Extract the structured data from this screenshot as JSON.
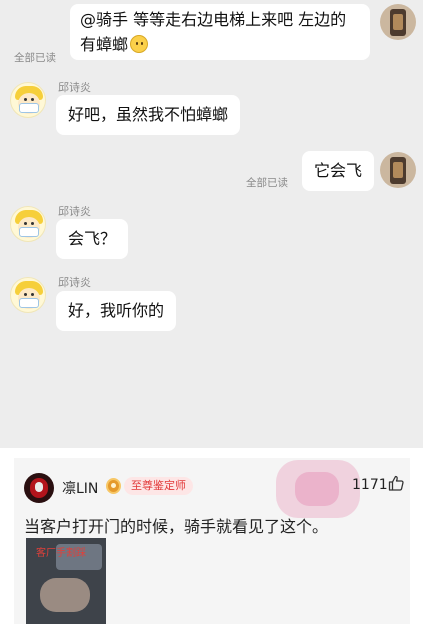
{
  "chat": {
    "messages": [
      {
        "side": "right",
        "line1": "@骑手 等等走右边电梯上来吧 左边的",
        "line2": "有蟑螂",
        "emoji": "flushed-face-emoji",
        "status": "全部已读"
      },
      {
        "side": "left",
        "sender": "邱诗炎",
        "text": "好吧，虽然我不怕蟑螂"
      },
      {
        "side": "right",
        "text": "它会飞",
        "status": "全部已读"
      },
      {
        "side": "left",
        "sender": "邱诗炎",
        "text": "会飞？"
      },
      {
        "side": "left",
        "sender": "邱诗炎",
        "text": "好，我听你的"
      }
    ]
  },
  "comment": {
    "username": "凛LIN",
    "badge": "至尊鉴定师",
    "likes": "1171",
    "text": "当客户打开门的时候，骑手就看见了这个。",
    "image_caption": "客厂手割踩",
    "icons": {
      "medal": "medal-icon",
      "like": "thumbs-up-icon"
    },
    "colors": {
      "badge_text": "#e23a3a",
      "badge_bg": "#fde6e6",
      "chat_bg": "#ededed"
    }
  }
}
